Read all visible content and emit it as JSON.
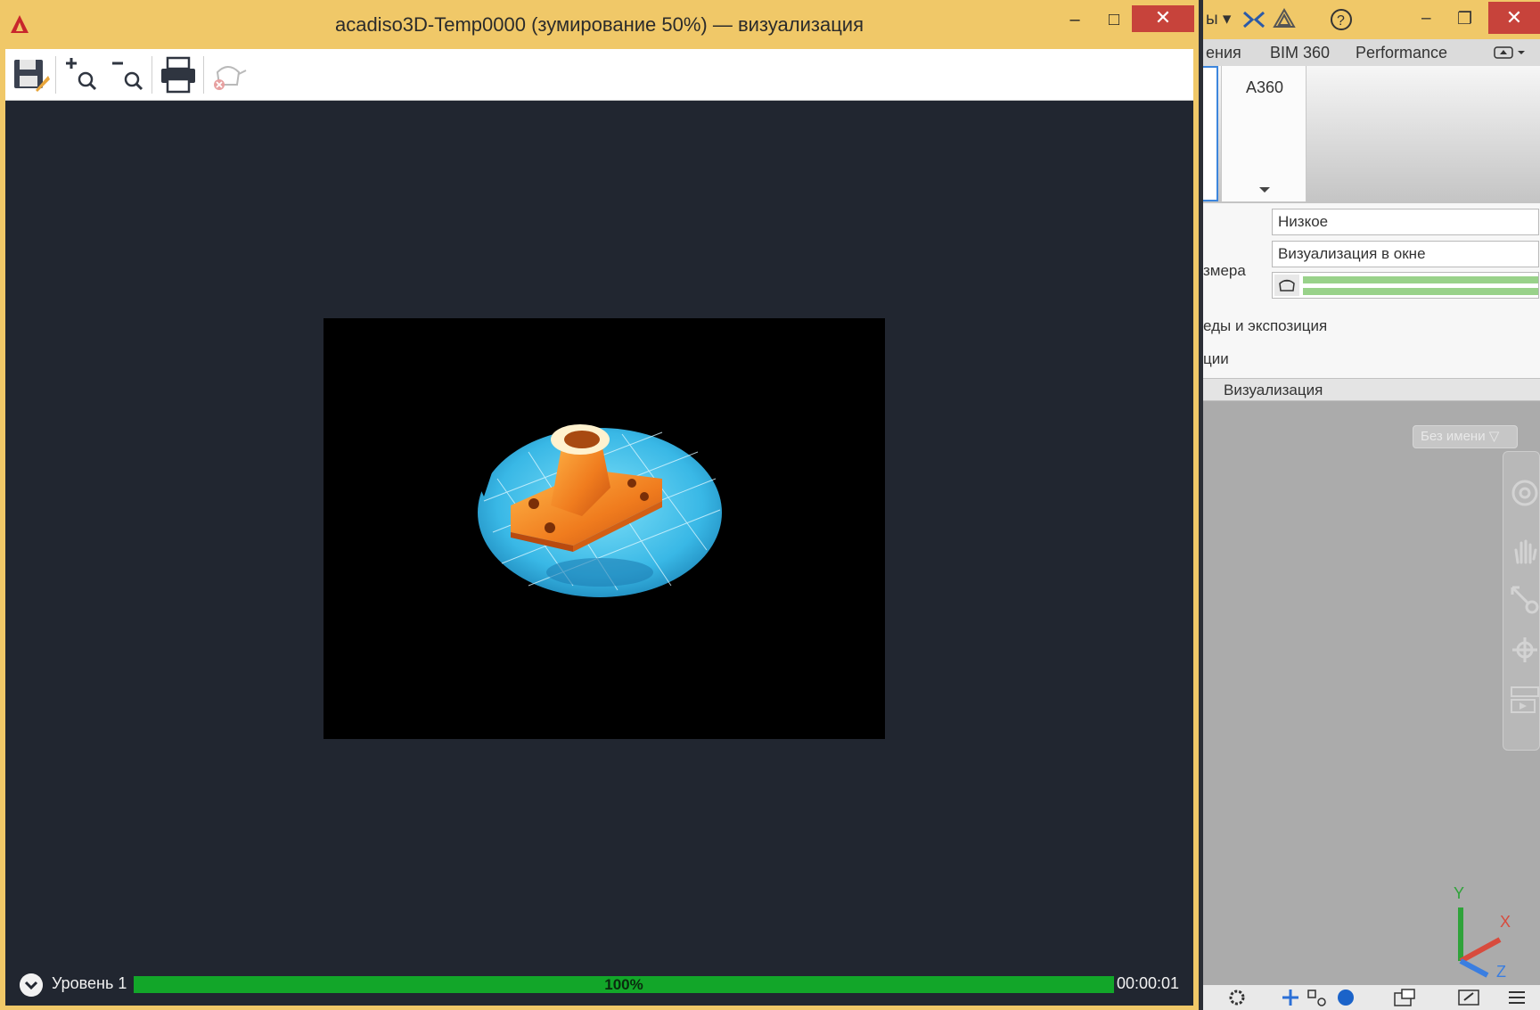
{
  "render_window": {
    "title": "acadiso3D-Temp0000 (зумирование 50%) — визуализация",
    "buttons": {
      "minimize": "–",
      "maximize": "□",
      "close": "✕"
    },
    "toolbar": {
      "icons": [
        "save-icon",
        "zoom-in-icon",
        "zoom-out-icon",
        "print-icon",
        "cancel-render-icon"
      ]
    },
    "status": {
      "level_label": "Уровень 1",
      "progress_text": "100%",
      "progress_value": 1.0,
      "elapsed": "00:00:01"
    }
  },
  "background_app": {
    "title_fragment": "ы ▾",
    "title_icons": [
      "exchange-icon",
      "autodesk-icon",
      "help-icon"
    ],
    "close_label": "✕",
    "min_label": "–",
    "restore_label": "❐",
    "ribbon_tabs": [
      "ения",
      "BIM 360",
      "Performance"
    ],
    "panel_tab": "A360",
    "props": {
      "quality": "Низкое",
      "render_target": "Визуализация в окне",
      "size_label_fragment": "змера",
      "environment_label": "еды и экспозиция",
      "other_label": "ции"
    },
    "section_label": "Визуализация",
    "view_pill": "Без имени ▽",
    "ucs": {
      "y_label": "Y",
      "x_label": "X",
      "z_label": "Z"
    }
  },
  "colors": {
    "title_bar": "#f0c868",
    "render_bg": "#212630",
    "progress_fill": "#12a629",
    "close_red": "#c7433b"
  }
}
